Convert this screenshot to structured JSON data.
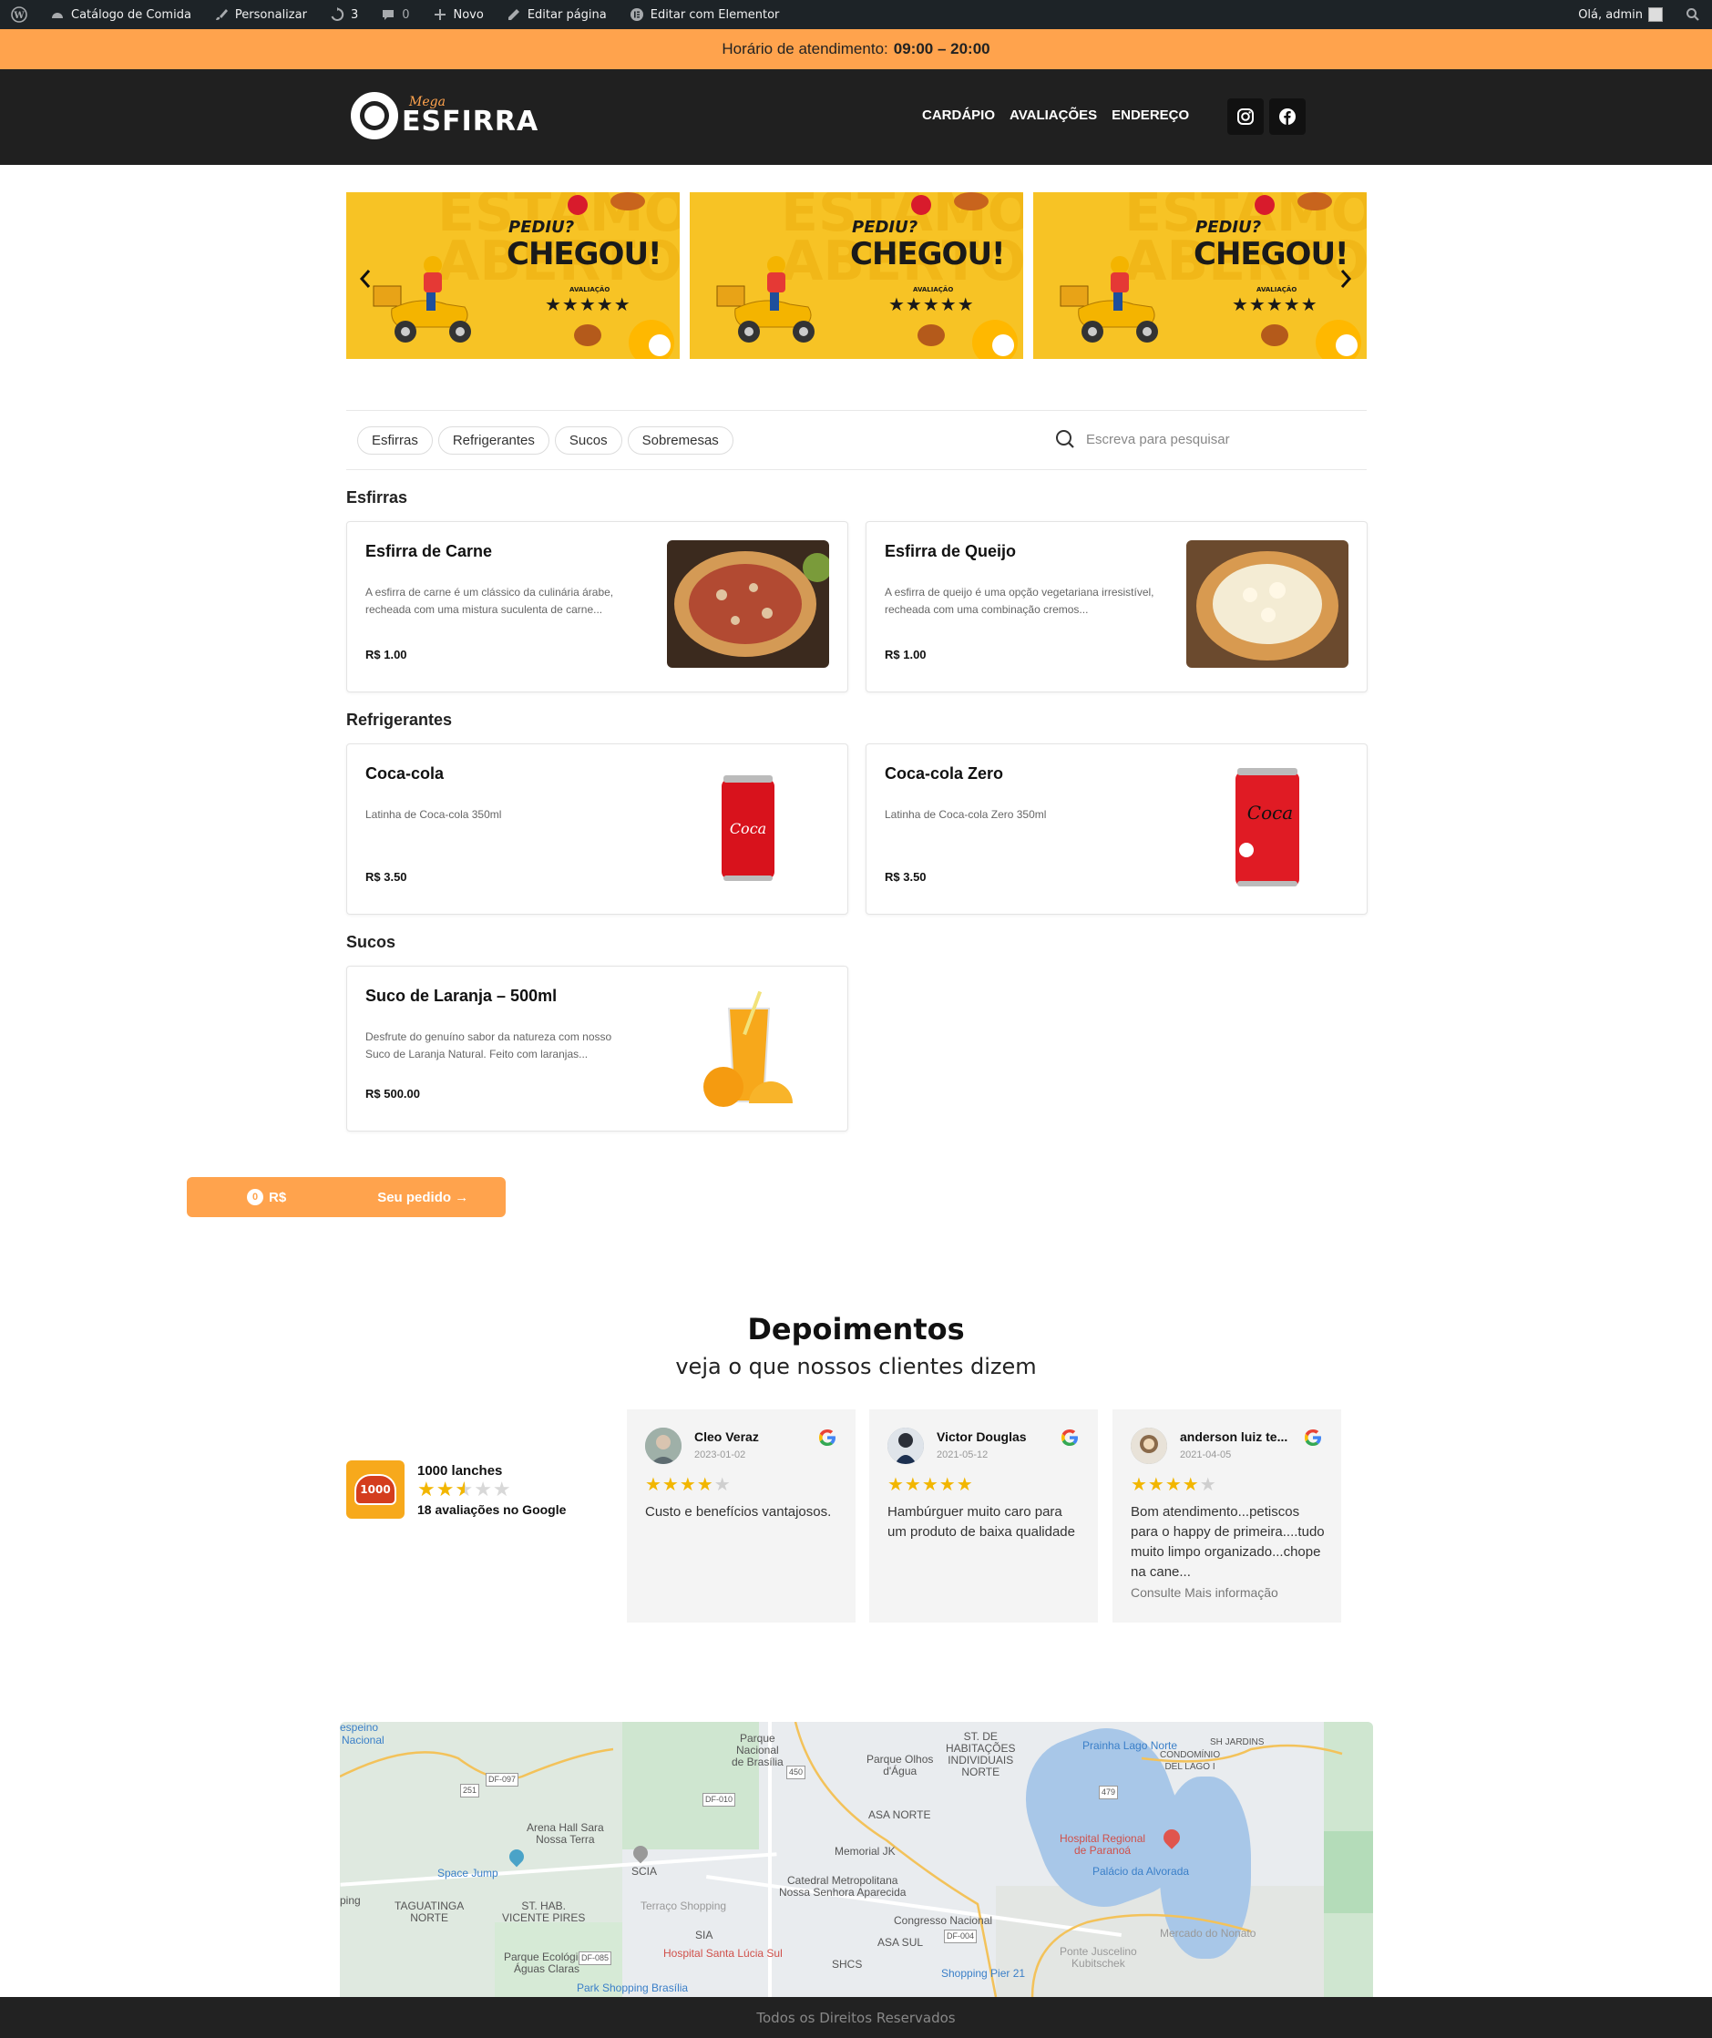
{
  "admin_bar": {
    "site_name": "Catálogo de Comida",
    "customize": "Personalizar",
    "updates_count": "3",
    "comments_count": "0",
    "new_label": "Novo",
    "edit_page": "Editar página",
    "edit_elementor": "Editar com Elementor",
    "greeting": "Olá, admin"
  },
  "hours": {
    "label": "Horário de atendimento:",
    "value": "09:00 – 20:00"
  },
  "header": {
    "logo_small": "Mega",
    "logo_big": "ESFIRRA",
    "nav": [
      "CARDÁPIO",
      "AVALIAÇÕES",
      "ENDEREÇO"
    ]
  },
  "carousel": {
    "slides": [
      {
        "line1": "PEDIU?",
        "line2": "CHEGOU!",
        "rating_label": "AVALIAÇÃO",
        "stars": "★★★★★"
      },
      {
        "line1": "PEDIU?",
        "line2": "CHEGOU!",
        "rating_label": "AVALIAÇÃO",
        "stars": "★★★★★"
      },
      {
        "line1": "PEDIU?",
        "line2": "CHEGOU!",
        "rating_label": "AVALIAÇÃO",
        "stars": "★★★★★"
      }
    ],
    "prev_icon": "chevron-left-icon",
    "next_icon": "chevron-right-icon"
  },
  "filters": {
    "chips": [
      "Esfirras",
      "Refrigerantes",
      "Sucos",
      "Sobremesas"
    ],
    "search_placeholder": "Escreva para pesquisar"
  },
  "menu": {
    "sections": [
      {
        "title": "Esfirras",
        "items": [
          {
            "name": "Esfirra de Carne",
            "desc": "A esfirra de carne é um clássico da culinária árabe, recheada com uma mistura suculenta de carne...",
            "price": "R$ 1.00"
          },
          {
            "name": "Esfirra de Queijo",
            "desc": "A esfirra de queijo é uma opção vegetariana irresistível, recheada com uma combinação cremos...",
            "price": "R$ 1.00"
          }
        ]
      },
      {
        "title": "Refrigerantes",
        "items": [
          {
            "name": "Coca-cola",
            "desc": "Latinha de Coca-cola 350ml",
            "price": "R$ 3.50"
          },
          {
            "name": "Coca-cola Zero",
            "desc": "Latinha de Coca-cola Zero 350ml",
            "price": "R$ 3.50"
          }
        ]
      },
      {
        "title": "Sucos",
        "items": [
          {
            "name": "Suco de Laranja – 500ml",
            "desc": "Desfrute do genuíno sabor da natureza com nosso Suco de Laranja Natural. Feito com laranjas...",
            "price": "R$ 500.00"
          }
        ]
      }
    ]
  },
  "cart": {
    "count": "0",
    "currency": "R$",
    "label": "Seu pedido →"
  },
  "testimonials": {
    "title": "Depoimentos",
    "subtitle": "veja o que nossos clientes dizem",
    "business": {
      "name": "1000 lanches",
      "rating": 2.5,
      "logo_text": "1000",
      "count_label": "18 avaliações no Google"
    },
    "reviews": [
      {
        "name": "Cleo Veraz",
        "date": "2023-01-02",
        "stars": 4,
        "text": "Custo e benefícios vantajosos.",
        "more": ""
      },
      {
        "name": "Victor Douglas",
        "date": "2021-05-12",
        "stars": 5,
        "text": "Hambúrguer muito caro para um produto de baixa qualidade",
        "more": ""
      },
      {
        "name": "anderson luiz te...",
        "date": "2021-04-05",
        "stars": 4,
        "text": "Bom atendimento...petiscos para o happy de primeira....tudo muito limpo organizado...chope na cane...",
        "more": "Consulte Mais informação"
      }
    ]
  },
  "map": {
    "labels": [
      "espeino",
      "Nacional",
      "Parque Nacional de Brasília",
      "Parque Olhos d'Água",
      "ST. DE HABITAÇÕES INDIVIDUAIS NORTE",
      "Prainha Lago Norte",
      "SH JARDINS",
      "CONDOMÍNIO DEL LAGO I",
      "Arena Hall Sara Nossa Terra",
      "ASA NORTE",
      "Memorial JK",
      "Hospital Regional de Paranoá",
      "Palácio da Alvorada",
      "Space Jump",
      "SCIA",
      "Catedral Metropolitana Nossa Senhora Aparecida",
      "TAGUATINGA NORTE",
      "ST. HAB. VICENTE PIRES",
      "Terraço Shopping",
      "Congresso Nacional",
      "Mercado do Nonato",
      "SIA",
      "ASA SUL",
      "Parque Ecológico Águas Claras",
      "Hospital Santa Lúcia Sul",
      "SHCS",
      "Ponte Juscelino Kubitschek",
      "Park Shopping Brasília",
      "Shopping Pier 21",
      "DF-097",
      "251",
      "DF-010",
      "450",
      "479",
      "DF-004",
      "DF-085",
      "ping"
    ]
  },
  "footer": {
    "text": "Todos os Direitos Reservados"
  }
}
